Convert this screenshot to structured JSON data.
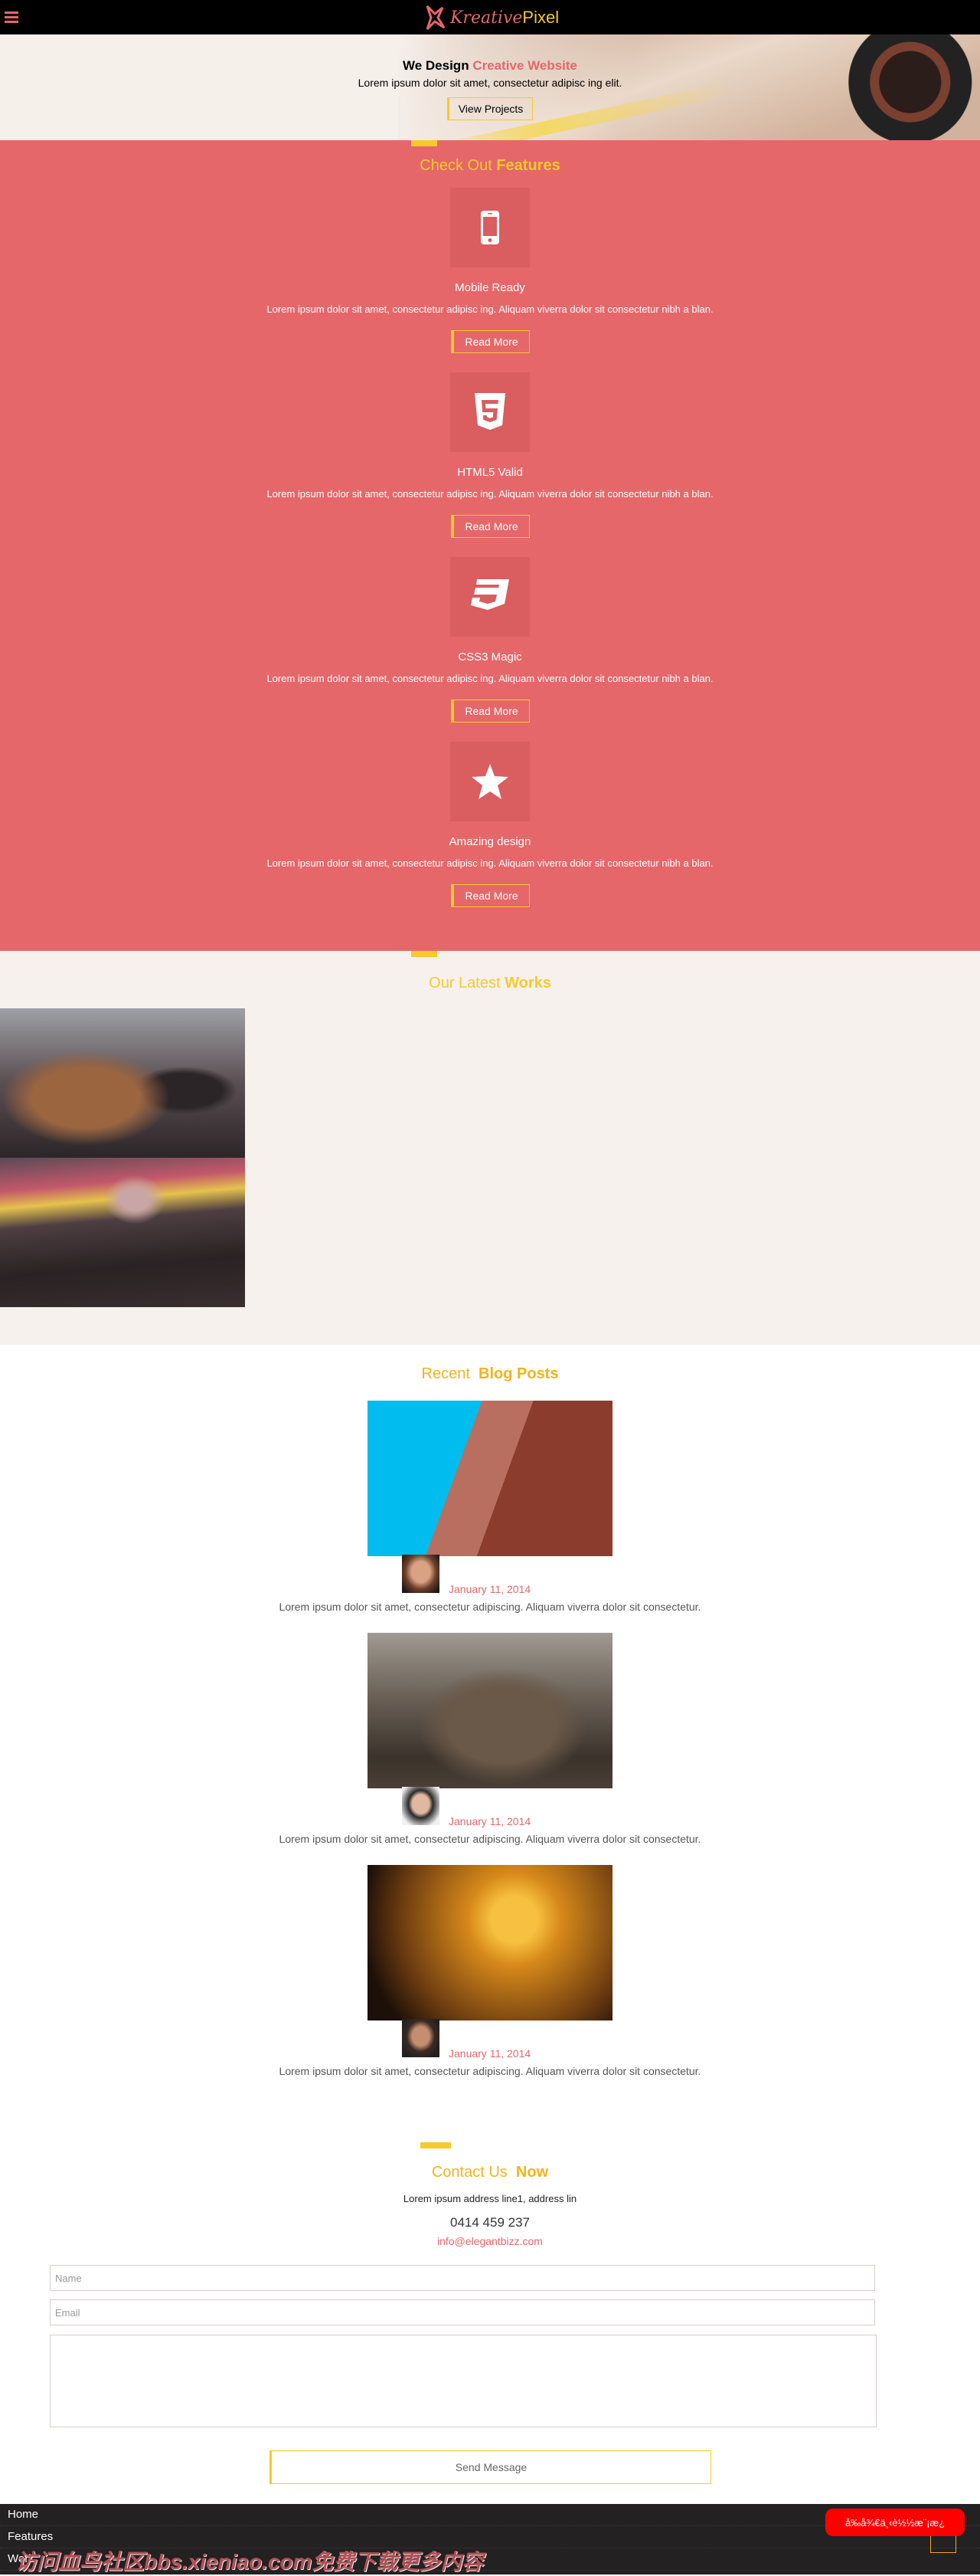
{
  "nav": {
    "logo_part1": "Kreative",
    "logo_part2": "Pixel",
    "menu_icon": "hamburger-icon"
  },
  "hero": {
    "title_plain": "We Design",
    "title_accent": "Creative Website",
    "subtitle": "Lorem ipsum dolor sit amet, consectetur adipisc ing elit.",
    "button": "View Projects"
  },
  "features": {
    "title_plain": "Check Out",
    "title_bold": "Features",
    "items": [
      {
        "icon": "mobile-phone-icon",
        "title": "Mobile Ready",
        "desc": "Lorem ipsum dolor sit amet, consectetur adipisc ing. Aliquam viverra dolor sit consectetur nibh a blan.",
        "button": "Read More"
      },
      {
        "icon": "html5-icon",
        "title": "HTML5 Valid",
        "desc": "Lorem ipsum dolor sit amet, consectetur adipisc ing. Aliquam viverra dolor sit consectetur nibh a blan.",
        "button": "Read More"
      },
      {
        "icon": "css3-icon",
        "title": "CSS3 Magic",
        "desc": "Lorem ipsum dolor sit amet, consectetur adipisc ing. Aliquam viverra dolor sit consectetur nibh a blan.",
        "button": "Read More"
      },
      {
        "icon": "star-icon",
        "title": "Amazing design",
        "desc": "Lorem ipsum dolor sit amet, consectetur adipisc ing. Aliquam viverra dolor sit consectetur nibh a blan.",
        "button": "Read More"
      }
    ]
  },
  "works": {
    "title_plain": "Our Latest",
    "title_bold": "Works"
  },
  "blog": {
    "title_plain": "Recent",
    "title_bold": "Blog Posts",
    "posts": [
      {
        "date": "January 11, 2014",
        "text": "Lorem ipsum dolor sit amet, consectetur adipiscing. Aliquam viverra dolor sit consectetur."
      },
      {
        "date": "January 11, 2014",
        "text": "Lorem ipsum dolor sit amet, consectetur adipiscing. Aliquam viverra dolor sit consectetur."
      },
      {
        "date": "January 11, 2014",
        "text": "Lorem ipsum dolor sit amet, consectetur adipiscing. Aliquam viverra dolor sit consectetur."
      }
    ]
  },
  "contact": {
    "title_plain": "Contact Us",
    "title_bold": "Now",
    "address": "Lorem ipsum address line1, address lin",
    "phone": "0414 459 237",
    "email": "info@elegantbizz.com",
    "name_placeholder": "Name",
    "email_placeholder": "Email",
    "send": "Send Message"
  },
  "footer": {
    "menu": [
      "Home",
      "Features",
      "Work"
    ],
    "badge": "å‰å¾€ä¸‹è½½æ¨¡æ¿",
    "watermark": "访问血鸟社区bbs.xieniao.com免费下载更多内容"
  },
  "colors": {
    "coral": "#e5676a",
    "yellow": "#f8c92b",
    "cream": "#f6f1ed",
    "footer": "#232122"
  }
}
